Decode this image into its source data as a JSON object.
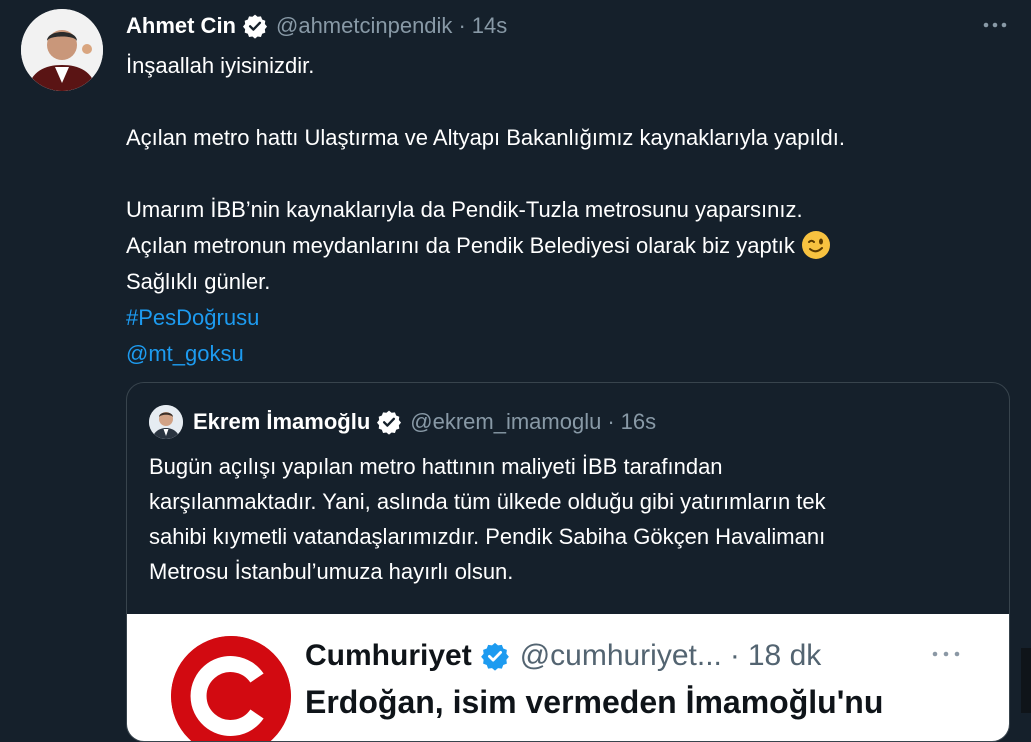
{
  "tweet": {
    "author_name": "Ahmet Cin",
    "author_handle": "@ahmetcinpendik",
    "separator": "·",
    "time": "14s",
    "lines": [
      "İnşaallah iyisinizdir.",
      "",
      "Açılan metro hattı Ulaştırma ve Altyapı Bakanlığımız kaynaklarıyla yapıldı.",
      "",
      "Umarım İBB’nin kaynaklarıyla da Pendik-Tuzla metrosunu yaparsınız.",
      "Açılan metronun meydanlarını da Pendik Belediyesi olarak biz yaptık",
      "Sağlıklı günler."
    ],
    "hashtag": "#PesDoğrusu",
    "mention": "@mt_goksu",
    "emoji": "winking-face"
  },
  "quoted": {
    "author_name": "Ekrem İmamoğlu",
    "author_handle": "@ekrem_imamoglu",
    "separator": "·",
    "time": "16s",
    "lines": [
      "Bugün açılışı yapılan metro hattının maliyeti İBB tarafından",
      "karşılanmaktadır. Yani, aslında tüm ülkede olduğu gibi yatırımların tek",
      "sahibi kıymetli vatandaşlarımızdır. Pendik Sabiha Gökçen Havalimanı",
      "Metrosu İstanbul’umuza hayırlı olsun."
    ]
  },
  "embedded_image": {
    "account_name": "Cumhuriyet",
    "account_handle": "@cumhuriyet...",
    "separator": "·",
    "time": "18 dk",
    "headline": "Erdoğan, isim vermeden İmamoğlu'nu"
  },
  "colors": {
    "background": "#15202b",
    "text": "#ffffff",
    "muted": "#8899a6",
    "link": "#1d9bf0",
    "border": "#38444d",
    "verified": "#ffffff",
    "brand_red": "#d20a11"
  }
}
